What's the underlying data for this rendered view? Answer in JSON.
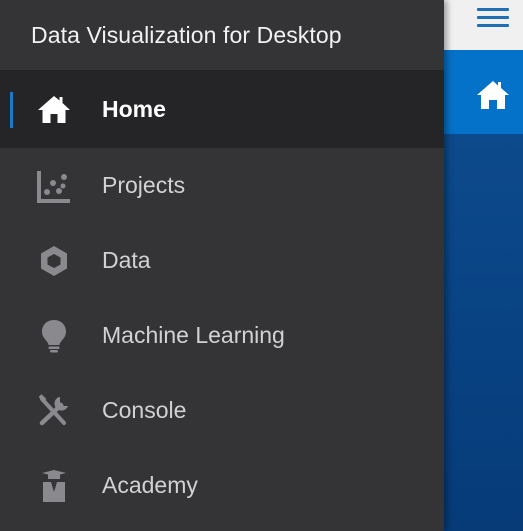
{
  "app": {
    "title": "Data Visualization for Desktop"
  },
  "nav": {
    "items": [
      {
        "id": "home",
        "label": "Home",
        "icon": "home-icon",
        "active": true
      },
      {
        "id": "projects",
        "label": "Projects",
        "icon": "scatter-plot-icon",
        "active": false
      },
      {
        "id": "data",
        "label": "Data",
        "icon": "hexagon-icon",
        "active": false
      },
      {
        "id": "machine-learning",
        "label": "Machine Learning",
        "icon": "lightbulb-icon",
        "active": false
      },
      {
        "id": "console",
        "label": "Console",
        "icon": "tools-icon",
        "active": false
      },
      {
        "id": "academy",
        "label": "Academy",
        "icon": "graduate-icon",
        "active": false
      }
    ]
  },
  "toolbar": {
    "menu_icon": "hamburger-menu-icon",
    "home_icon": "home-icon"
  },
  "colors": {
    "drawer_bg": "#343436",
    "active_bg": "#252528",
    "accent": "#1a7bc9",
    "home_tile": "#0472c9",
    "content_bg": "#0a4688"
  }
}
